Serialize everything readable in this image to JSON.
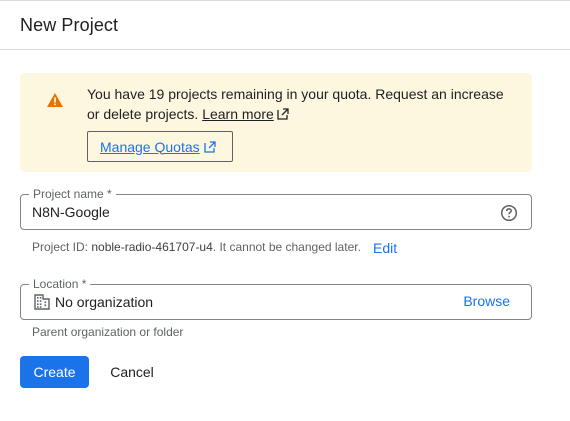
{
  "header": {
    "title": "New Project"
  },
  "quota_banner": {
    "message": "You have 19 projects remaining in your quota. Request an increase or delete projects.",
    "learn_more_label": "Learn more",
    "manage_quotas_label": "Manage Quotas",
    "icon": "warning-icon",
    "accent_color": "#e37400"
  },
  "project_name": {
    "label": "Project name *",
    "value": "N8N-Google",
    "help_icon": "help-circle-icon"
  },
  "project_id": {
    "prefix": "Project ID:",
    "id": "noble-radio-461707-u4",
    "suffix": ". It cannot be changed later.",
    "edit_label": "Edit"
  },
  "location": {
    "label": "Location *",
    "value": "No organization",
    "browse_label": "Browse",
    "icon": "building-icon",
    "hint": "Parent organization or folder"
  },
  "actions": {
    "create_label": "Create",
    "cancel_label": "Cancel"
  },
  "colors": {
    "primary": "#1a73e8",
    "banner_bg": "#fef7e0"
  }
}
